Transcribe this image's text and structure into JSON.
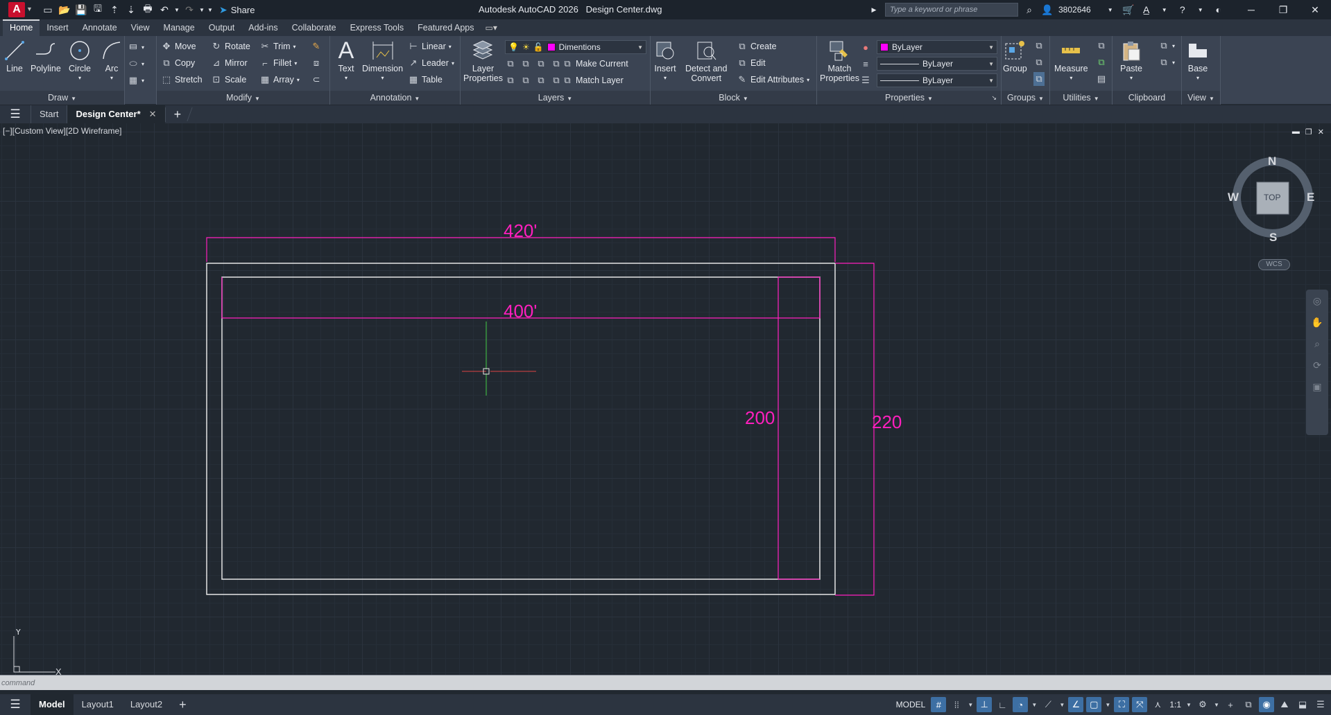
{
  "title_bar": {
    "app_name": "Autodesk AutoCAD 2026",
    "file_name": "Design Center.dwg",
    "share_label": "Share",
    "search_placeholder": "Type a keyword or phrase",
    "user_id": "3802646"
  },
  "ribbon_tabs": [
    "Home",
    "Insert",
    "Annotate",
    "View",
    "Manage",
    "Output",
    "Add-ins",
    "Collaborate",
    "Express Tools",
    "Featured Apps"
  ],
  "active_tab": "Home",
  "draw_panel": {
    "title": "Draw",
    "line": "Line",
    "polyline": "Polyline",
    "circle": "Circle",
    "arc": "Arc"
  },
  "modify_panel": {
    "title": "Modify",
    "move": "Move",
    "rotate": "Rotate",
    "trim": "Trim",
    "copy": "Copy",
    "mirror": "Mirror",
    "fillet": "Fillet",
    "stretch": "Stretch",
    "scale": "Scale",
    "array": "Array"
  },
  "annotation_panel": {
    "title": "Annotation",
    "text": "Text",
    "dimension": "Dimension",
    "linear": "Linear",
    "leader": "Leader",
    "table": "Table"
  },
  "layers_panel": {
    "title": "Layers",
    "layer_properties_line1": "Layer",
    "layer_properties_line2": "Properties",
    "current_layer": "Dimentions",
    "layer_color": "#ff00ff",
    "make_current": "Make Current",
    "match_layer": "Match Layer"
  },
  "block_panel": {
    "title": "Block",
    "insert": "Insert",
    "detect_line1": "Detect and",
    "detect_line2": "Convert",
    "create": "Create",
    "edit": "Edit",
    "edit_attributes": "Edit Attributes"
  },
  "properties_panel": {
    "title": "Properties",
    "match_line1": "Match",
    "match_line2": "Properties",
    "color_value": "ByLayer",
    "lineweight_value": "ByLayer",
    "linetype_value": "ByLayer",
    "color_swatch": "#ff00ff"
  },
  "groups_panel": {
    "title": "Groups",
    "group": "Group"
  },
  "utilities_panel": {
    "title": "Utilities",
    "measure": "Measure"
  },
  "clipboard_panel": {
    "title": "Clipboard",
    "paste": "Paste"
  },
  "view_panel": {
    "title": "View",
    "base": "Base"
  },
  "file_tabs": {
    "start": "Start",
    "active": "Design Center*"
  },
  "viewport": {
    "label": "[−][Custom View][2D Wireframe]"
  },
  "drawing": {
    "dim_top_outer": "420'",
    "dim_top_inner": "400'",
    "dim_right_inner": "200",
    "dim_right_outer": "220",
    "dimension_color": "#ff1fbe",
    "geometry_color": "#e6e6e6"
  },
  "viewcube": {
    "north": "N",
    "south": "S",
    "east": "E",
    "west": "W",
    "face": "TOP",
    "wcs": "WCS"
  },
  "ucs": {
    "y": "Y",
    "x": "X"
  },
  "command_line": {
    "placeholder": "command"
  },
  "layout_tabs": [
    "Model",
    "Layout1",
    "Layout2"
  ],
  "status_bar": {
    "model_label": "MODEL",
    "scale": "1:1"
  }
}
